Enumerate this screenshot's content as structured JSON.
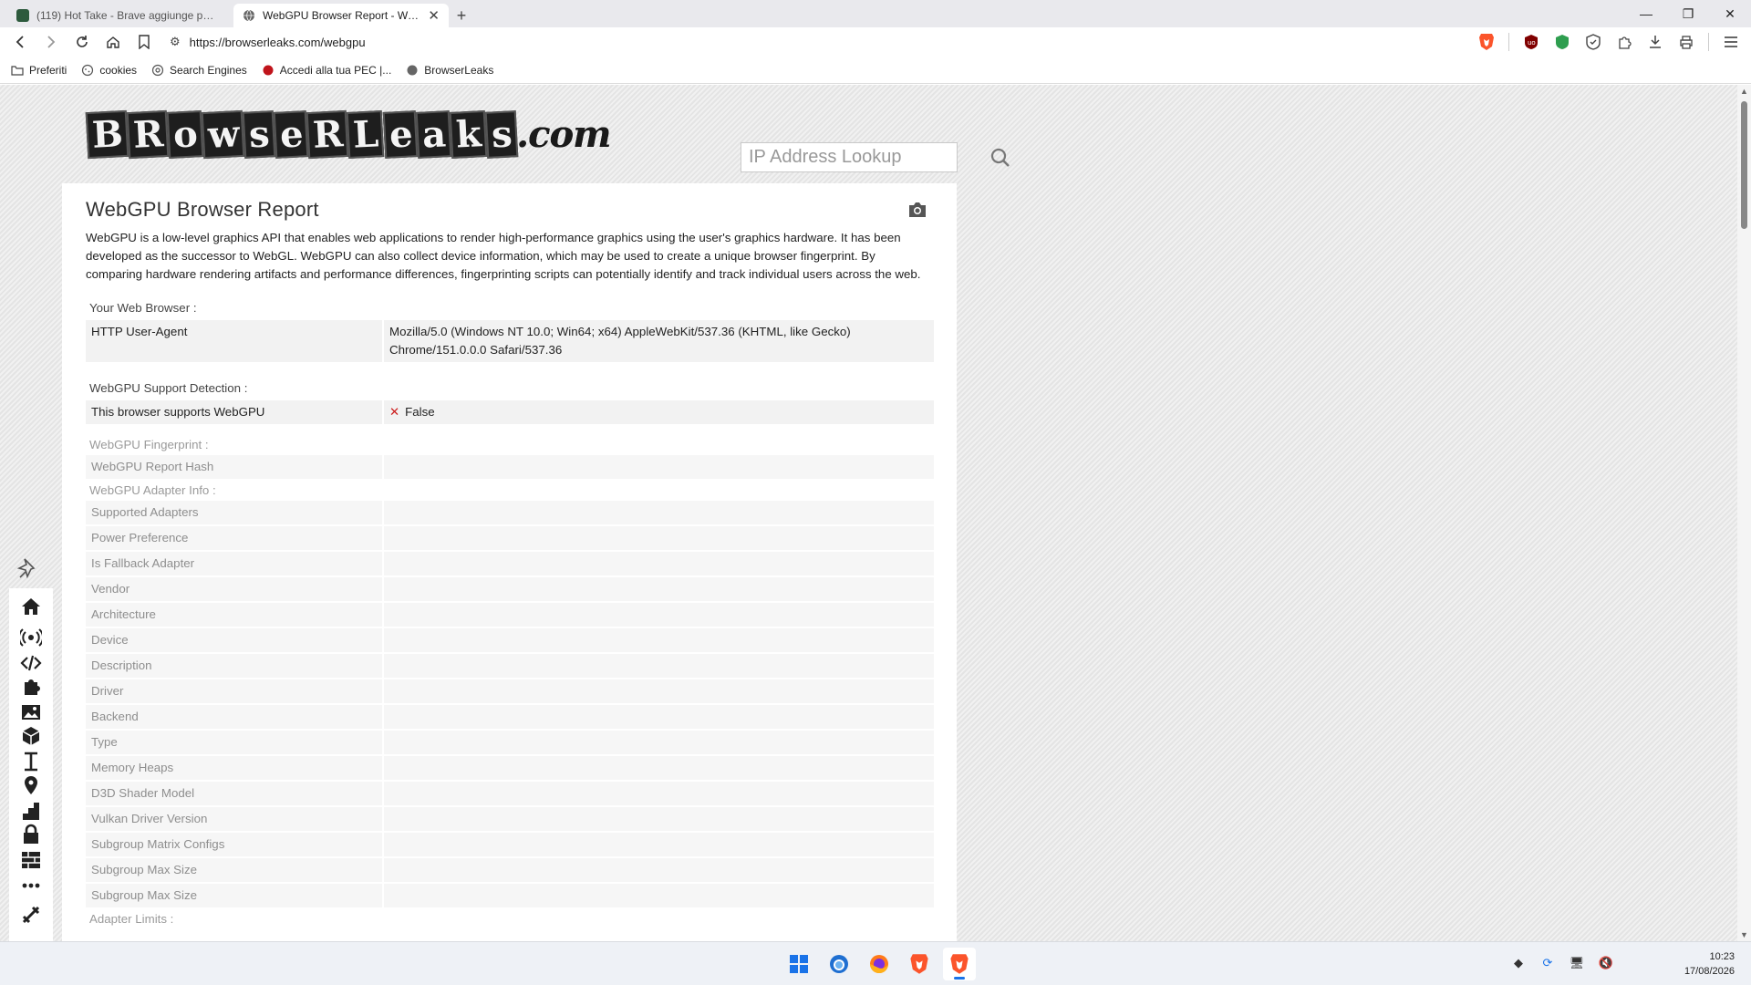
{
  "tabs": [
    {
      "label": "(119) Hot Take - Brave aggiunge prote",
      "active": false
    },
    {
      "label": "WebGPU Browser Report - WebGPU",
      "active": true
    }
  ],
  "url": "https://browserleaks.com/webgpu",
  "bookmarks": [
    "Preferiti",
    "cookies",
    "Search Engines",
    "Accedi alla tua PEC |...",
    "BrowserLeaks"
  ],
  "site": {
    "search_placeholder": "IP Address Lookup",
    "title": "WebGPU Browser Report",
    "intro": "WebGPU is a low-level graphics API that enables web applications to render high-performance graphics using the user's graphics hardware. It has been developed as the successor to WebGL. WebGPU can also collect device information, which may be used to create a unique browser fingerprint. By comparing hardware rendering artifacts and performance differences, fingerprinting scripts can potentially identify and track individual users across the web."
  },
  "sections": {
    "browser": {
      "header": "Your Web Browser :",
      "ua_key": "HTTP User-Agent",
      "ua_value": "Mozilla/5.0 (Windows NT 10.0; Win64; x64) AppleWebKit/537.36 (KHTML, like Gecko) Chrome/151.0.0.0 Safari/537.36"
    },
    "support": {
      "header": "WebGPU Support Detection :",
      "key": "This browser supports WebGPU",
      "value": "False"
    },
    "fingerprint": {
      "header": "WebGPU Fingerprint :",
      "key": "WebGPU Report Hash"
    },
    "adapter": {
      "header": "WebGPU Adapter Info :",
      "rows": [
        "Supported Adapters",
        "Power Preference",
        "Is Fallback Adapter",
        "Vendor",
        "Architecture",
        "Device",
        "Description",
        "Driver",
        "Backend",
        "Type",
        "Memory Heaps",
        "D3D Shader Model",
        "Vulkan Driver Version",
        "Subgroup Matrix Configs",
        "Subgroup Max Size",
        "Subgroup Max Size"
      ]
    },
    "limits": {
      "header": "Adapter Limits :"
    }
  },
  "taskbar": {
    "time": "10:23",
    "date": "17/08/2026"
  },
  "colors": {
    "accent": "#1a73e8",
    "false_mark": "#cc1f1f",
    "brave": "#fb542b"
  }
}
